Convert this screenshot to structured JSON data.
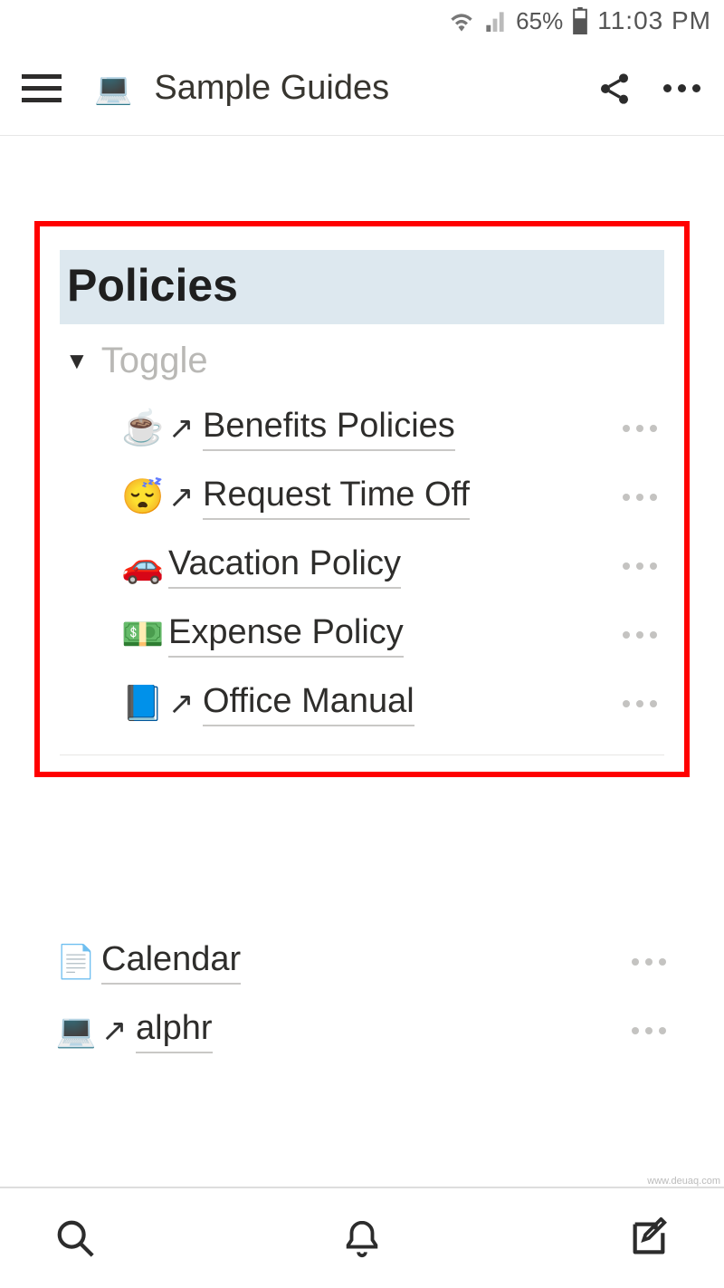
{
  "status": {
    "battery": "65%",
    "time": "11:03 PM"
  },
  "page": {
    "emoji": "💻",
    "title": "Sample Guides"
  },
  "heading": "Policies",
  "toggle_label": "Toggle",
  "policy_items": [
    {
      "emoji": "☕",
      "has_arrow": true,
      "label": "Benefits Policies"
    },
    {
      "emoji": "😴",
      "has_arrow": true,
      "label": "Request Time Off"
    },
    {
      "emoji": "🚗",
      "has_arrow": false,
      "label": "Vacation Policy"
    },
    {
      "emoji": "💵",
      "has_arrow": false,
      "label": "Expense Policy"
    },
    {
      "emoji": "📘",
      "has_arrow": true,
      "label": "Office Manual"
    }
  ],
  "other_items": [
    {
      "emoji": "📄",
      "has_arrow": false,
      "label": "Calendar"
    },
    {
      "emoji": "💻",
      "has_arrow": true,
      "label": "alphr"
    }
  ],
  "watermark": "www.deuaq.com"
}
